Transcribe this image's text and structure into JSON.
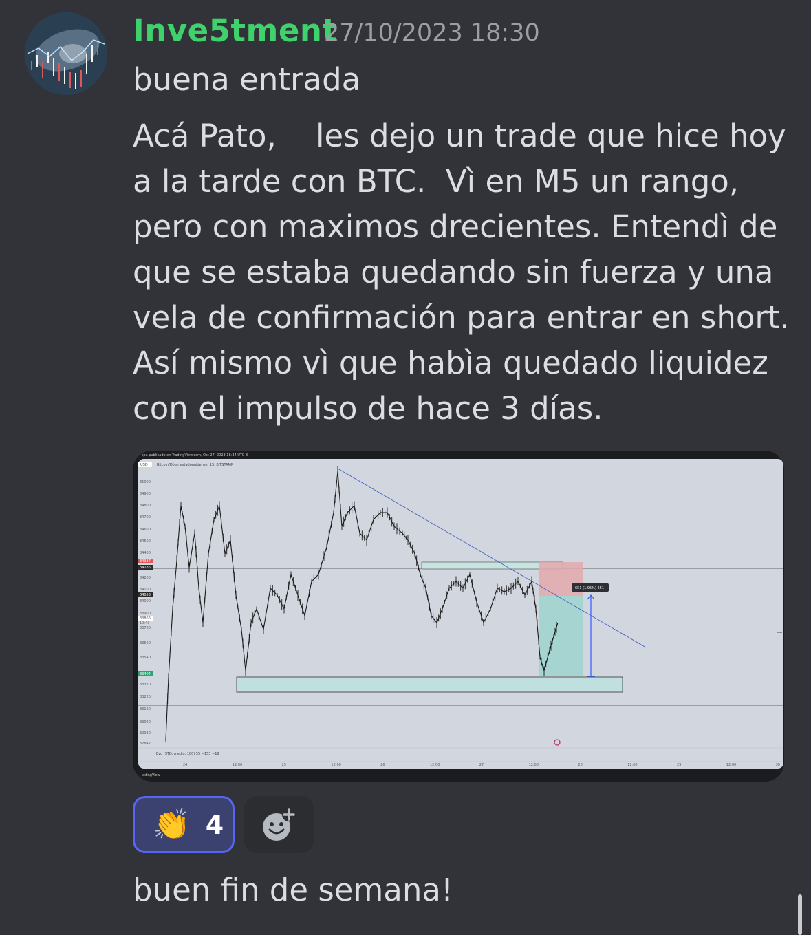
{
  "message": {
    "author": "Inve5tment",
    "timestamp": "27/10/2023 18:30",
    "text1": "buena entrada",
    "text2": "Acá Pato,    les dejo un trade que hice hoy a la tarde con BTC.  Vì en M5 un rango, pero con maximos drecientes. Entendì de que se estaba quedando sin fuerza y una vela de confirmación para entrar en short.  Así mismo vì que habìa quedado liquidez con el impulso de hace 3 días.",
    "text3": "buen fin de semana!"
  },
  "reactions": [
    {
      "emoji": "👏",
      "count": "4",
      "selected": true
    }
  ],
  "icons": {
    "add_reaction": "add-reaction-smiley-icon",
    "avatar": "avatar-image"
  },
  "colors": {
    "author": "#3fd16b",
    "background": "#313338",
    "reaction_border": "#5865f2"
  },
  "chart_image": {
    "header": "ıpa publicado en TradingView.com, Oct 27, 2023 18:34 UTC-3",
    "symbol": "Bitcoin/Dólar estadounidense, 15, BITSTAMP",
    "currency": "USD",
    "price_labels": [
      "35000",
      "34900",
      "34800",
      "34700",
      "34600",
      "34500",
      "34400",
      "34337",
      "34286",
      "34200",
      "34100",
      "34053",
      "34000",
      "33900",
      "33866",
      "10:43",
      "33780",
      "33660",
      "33540",
      "33404",
      "33320",
      "33220",
      "33120",
      "33020",
      "32930",
      "32842"
    ],
    "time_labels": [
      "24",
      "12:00",
      "25",
      "12:00",
      "26",
      "12:00",
      "27",
      "12:00",
      "28",
      "12:00",
      "29",
      "12:00",
      "30"
    ],
    "indicator": "Evo (STD, medio, 100)  55  −153  −19",
    "position_label": "651 (1.95%) 651",
    "footer": "adingView"
  }
}
